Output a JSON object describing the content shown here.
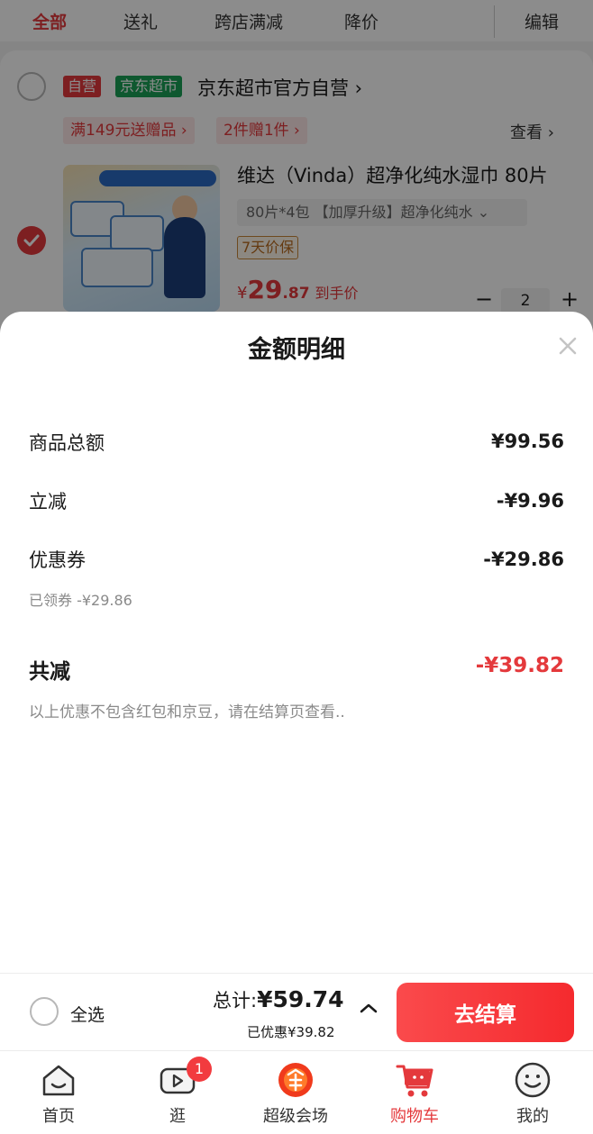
{
  "top_tabs": {
    "all": "全部",
    "gift": "送礼",
    "cross_store": "跨店满减",
    "price_drop": "降价",
    "edit": "编辑"
  },
  "shop": {
    "badge_self": "自营",
    "badge_jd": "京东超市",
    "name": "京东超市官方自营 ›",
    "promo_1": "满149元送赠品 ›",
    "promo_2": "2件赠1件 ›",
    "view": "查看 ›"
  },
  "product": {
    "title": "维达（Vinda）超净化纯水湿巾 80片",
    "spec": "80片*4包 【加厚升级】超净化纯水 ⌄",
    "guarantee": "7天价保",
    "price_currency": "¥",
    "price_int": "29",
    "price_dec": ".87",
    "price_label": "到手价",
    "qty_minus": "−",
    "qty": "2",
    "qty_plus": "+"
  },
  "sheet": {
    "title": "金额明细",
    "rows": [
      {
        "label": "商品总额",
        "value": "¥99.56"
      },
      {
        "label": "立减",
        "value": "-¥9.96"
      },
      {
        "label": "优惠券",
        "value": "-¥29.86"
      }
    ],
    "coupon_note": "已领券 -¥29.86",
    "total_label": "共减",
    "total_value": "-¥39.82",
    "disclaimer": "以上优惠不包含红包和京豆，请在结算页查看.."
  },
  "checkout": {
    "select_all": "全选",
    "total_prefix": "总计:",
    "total_amount": "¥59.74",
    "saved": "已优惠¥39.82",
    "pay": "去结算"
  },
  "tabbar": {
    "items": [
      {
        "label": "首页",
        "icon": "home-icon"
      },
      {
        "label": "逛",
        "icon": "video-icon",
        "badge": "1"
      },
      {
        "label": "超级会场",
        "icon": "venue-icon"
      },
      {
        "label": "购物车",
        "icon": "cart-icon"
      },
      {
        "label": "我的",
        "icon": "profile-icon"
      }
    ],
    "active": "购物车"
  },
  "colors": {
    "accent": "#e4393c",
    "jd_green": "#1aa057"
  }
}
